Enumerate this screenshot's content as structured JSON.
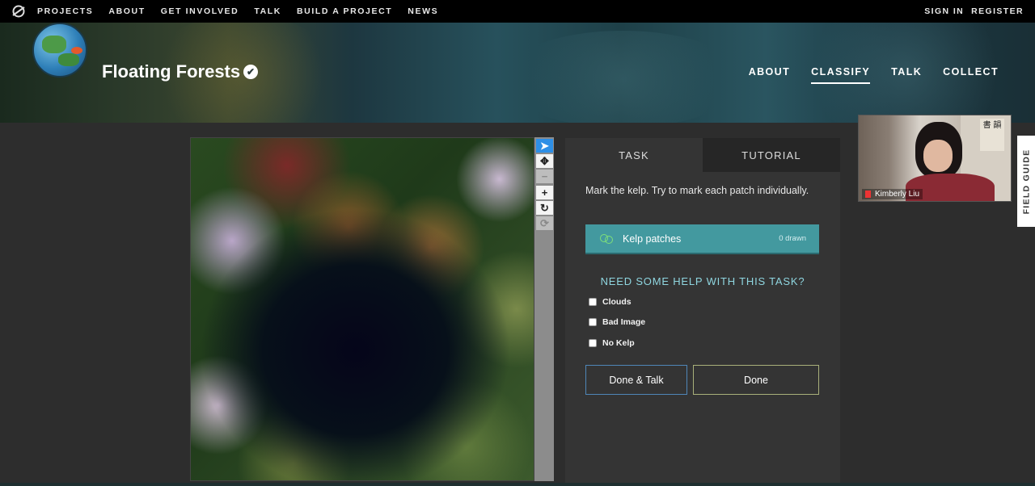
{
  "topnav": {
    "items": [
      "PROJECTS",
      "ABOUT",
      "GET INVOLVED",
      "TALK",
      "BUILD A PROJECT",
      "NEWS"
    ],
    "sign_in": "SIGN IN",
    "register": "REGISTER"
  },
  "project": {
    "title": "Floating Forests",
    "verified_icon": "✔",
    "nav": [
      "ABOUT",
      "CLASSIFY",
      "TALK",
      "COLLECT"
    ],
    "active_nav": "CLASSIFY"
  },
  "toolbar": {
    "icons": [
      "pointer-icon",
      "pan-icon",
      "zoom-out-icon",
      "zoom-in-icon",
      "rotate-icon",
      "reset-icon"
    ],
    "glyphs": [
      "➤",
      "✥",
      "−",
      "+",
      "↻",
      "⟳"
    ]
  },
  "task_panel": {
    "tab_task": "TASK",
    "tab_tutorial": "TUTORIAL",
    "instruction": "Mark the kelp. Try to mark each patch individually.",
    "tool_label": "Kelp patches",
    "tool_count": "0 drawn",
    "tool_color": "#43999f",
    "help_title": "NEED SOME HELP WITH THIS TASK?",
    "checkboxes": [
      "Clouds",
      "Bad Image",
      "No Kelp"
    ],
    "done_talk": "Done & Talk",
    "done": "Done"
  },
  "video": {
    "name": "Kimberly Liu",
    "art_text": "書 韻"
  },
  "field_guide": "FIELD GUIDE"
}
